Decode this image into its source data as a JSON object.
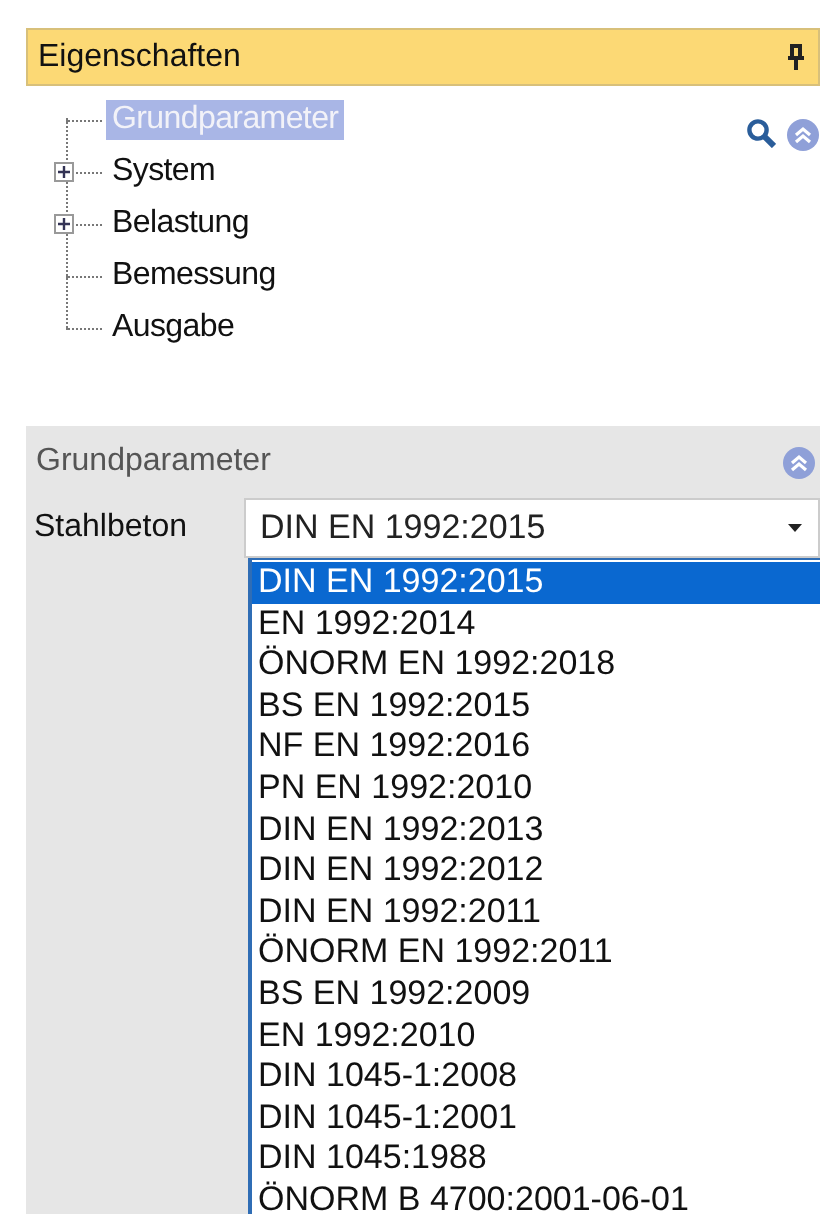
{
  "panel": {
    "title": "Eigenschaften"
  },
  "tree": {
    "items": [
      {
        "label": "Grundparameter",
        "kind": "leaf",
        "selected": true
      },
      {
        "label": "System",
        "kind": "group",
        "selected": false
      },
      {
        "label": "Belastung",
        "kind": "group",
        "selected": false
      },
      {
        "label": "Bemessung",
        "kind": "leaf",
        "selected": false
      },
      {
        "label": "Ausgabe",
        "kind": "leaf",
        "selected": false
      }
    ]
  },
  "section": {
    "title": "Grundparameter"
  },
  "property": {
    "label": "Stahlbeton",
    "value": "DIN EN 1992:2015"
  },
  "dropdown": {
    "options": [
      {
        "label": "DIN EN 1992:2015",
        "selected": true
      },
      {
        "label": "EN 1992:2014",
        "selected": false
      },
      {
        "label": "ÖNORM EN 1992:2018",
        "selected": false
      },
      {
        "label": "BS EN 1992:2015",
        "selected": false
      },
      {
        "label": "NF EN 1992:2016",
        "selected": false
      },
      {
        "label": "PN EN 1992:2010",
        "selected": false
      },
      {
        "label": "DIN EN 1992:2013",
        "selected": false
      },
      {
        "label": "DIN EN 1992:2012",
        "selected": false
      },
      {
        "label": "DIN EN 1992:2011",
        "selected": false
      },
      {
        "label": "ÖNORM EN 1992:2011",
        "selected": false
      },
      {
        "label": "BS EN 1992:2009",
        "selected": false
      },
      {
        "label": "EN 1992:2010",
        "selected": false
      },
      {
        "label": "DIN 1045-1:2008",
        "selected": false
      },
      {
        "label": "DIN 1045-1:2001",
        "selected": false
      },
      {
        "label": "DIN 1045:1988",
        "selected": false
      },
      {
        "label": "ÖNORM B 4700:2001-06-01",
        "selected": false
      }
    ]
  }
}
